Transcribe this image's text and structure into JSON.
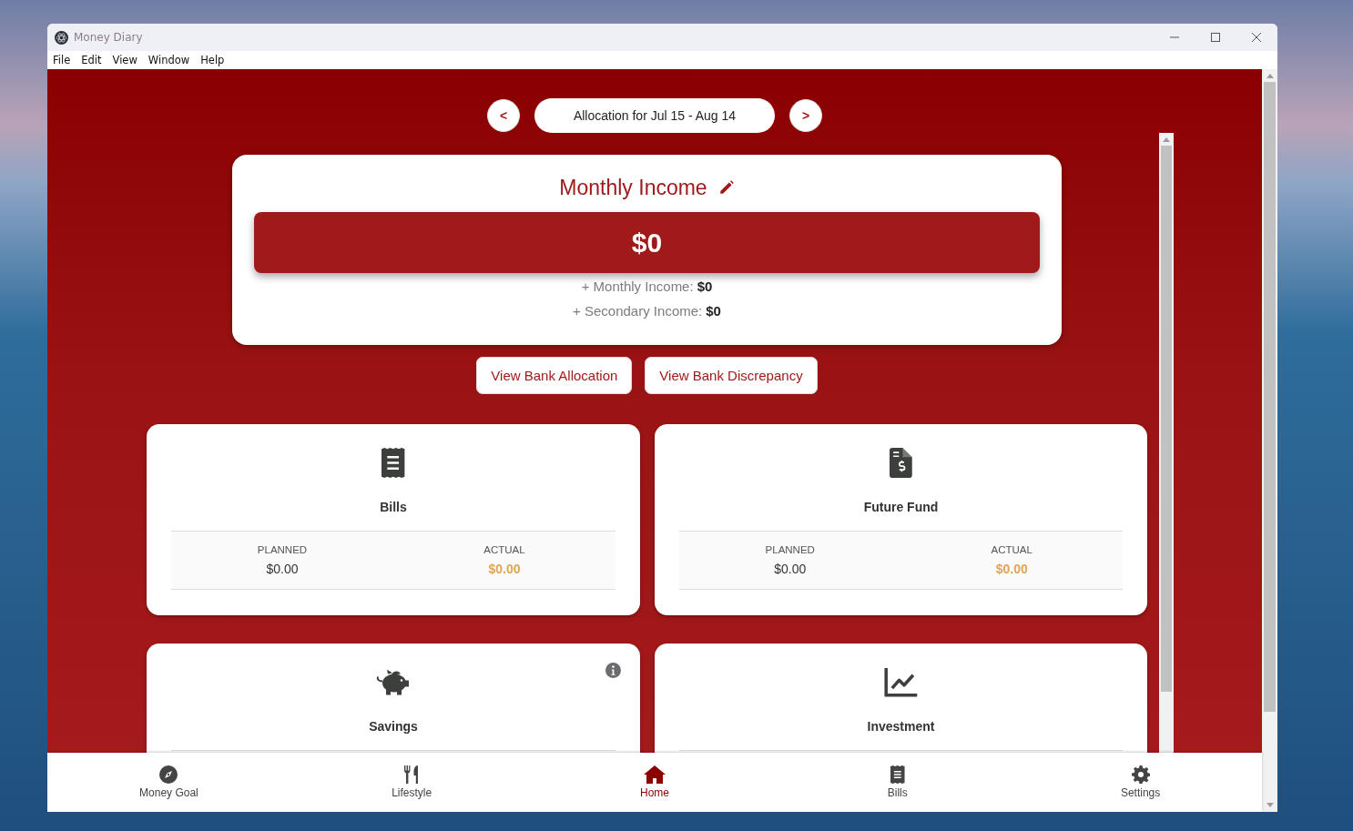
{
  "window": {
    "title": "Money Diary"
  },
  "menu": [
    "File",
    "Edit",
    "View",
    "Window",
    "Help"
  ],
  "period": {
    "prev": "<",
    "label": "Allocation for Jul 15 - Aug 14",
    "next": ">"
  },
  "income": {
    "title": "Monthly Income",
    "total": "$0",
    "lines": [
      {
        "label": "+ Monthly Income:",
        "value": "$0"
      },
      {
        "label": "+ Secondary Income:",
        "value": "$0"
      }
    ]
  },
  "buttons": [
    "View Bank Allocation",
    "View Bank Discrepancy"
  ],
  "categories": [
    {
      "kind": "bills",
      "name": "Bills",
      "info": false,
      "planned_label": "PLANNED",
      "planned": "$0.00",
      "actual_label": "ACTUAL",
      "actual": "$0.00"
    },
    {
      "kind": "future_fund",
      "name": "Future Fund",
      "info": false,
      "planned_label": "PLANNED",
      "planned": "$0.00",
      "actual_label": "ACTUAL",
      "actual": "$0.00"
    },
    {
      "kind": "savings",
      "name": "Savings",
      "info": true
    },
    {
      "kind": "investment",
      "name": "Investment",
      "info": false
    }
  ],
  "nav": [
    {
      "kind": "goal",
      "label": "Money Goal",
      "selected": false
    },
    {
      "kind": "lifestyle",
      "label": "Lifestyle",
      "selected": false
    },
    {
      "kind": "home",
      "label": "Home",
      "selected": true
    },
    {
      "kind": "bills",
      "label": "Bills",
      "selected": false
    },
    {
      "kind": "settings",
      "label": "Settings",
      "selected": false
    }
  ]
}
